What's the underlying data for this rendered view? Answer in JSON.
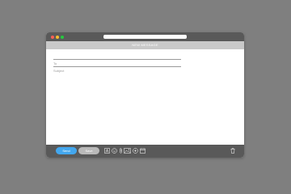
{
  "window": {
    "url": ""
  },
  "message": {
    "header_title": "NEW MESSAGE",
    "to_placeholder": "To",
    "subject_placeholder": "Subject",
    "body": ""
  },
  "toolbar": {
    "send_label": "Send",
    "save_label": "Save",
    "tools": [
      "format-text-icon",
      "emoji-icon",
      "attachment-icon",
      "image-icon",
      "link-icon",
      "calendar-icon",
      "trash-icon"
    ]
  },
  "colors": {
    "background": "#7f7f7f",
    "titlebar": "#595959",
    "header": "#c9c9c9",
    "send_button": "#43a7ee",
    "save_button": "#b9b9b9"
  }
}
